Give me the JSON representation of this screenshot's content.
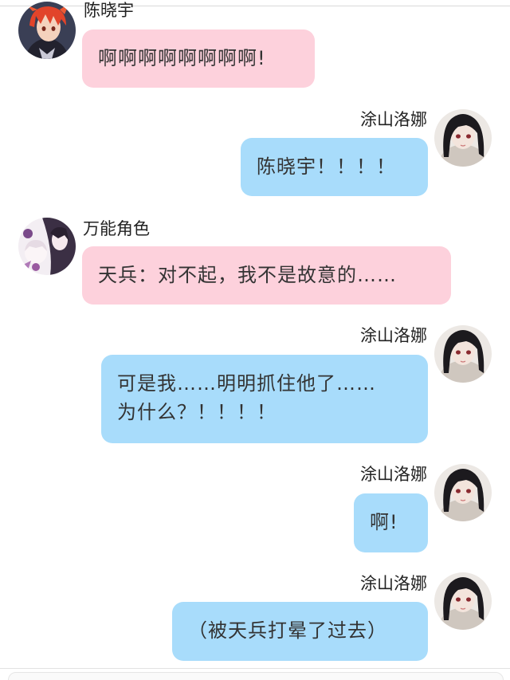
{
  "messages": [
    {
      "side": "left",
      "sender": "陈晓宇",
      "text": "啊啊啊啊啊啊啊啊!",
      "bubble_color": "#fdd1dc",
      "avatar": "red-hair-boy-avatar"
    },
    {
      "side": "right",
      "sender": "涂山洛娜",
      "text": "陈晓宇！！！！",
      "bubble_color": "#a8dcfb",
      "avatar": "dark-hair-girl-avatar"
    },
    {
      "side": "left",
      "sender": "万能角色",
      "text": "天兵：对不起，我不是故意的……",
      "bubble_color": "#fdd1dc",
      "avatar": "manga-characters-avatar"
    },
    {
      "side": "right",
      "sender": "涂山洛娜",
      "text_lines": [
        "可是我……明明抓住他了……",
        "为什么？！！！！"
      ],
      "bubble_color": "#a8dcfb",
      "avatar": "dark-hair-girl-avatar"
    },
    {
      "side": "right",
      "sender": "涂山洛娜",
      "text": "啊!",
      "bubble_color": "#a8dcfb",
      "avatar": "dark-hair-girl-avatar"
    },
    {
      "side": "right",
      "sender": "涂山洛娜",
      "text": "（被天兵打晕了过去）",
      "bubble_color": "#a8dcfb",
      "avatar": "dark-hair-girl-avatar"
    }
  ]
}
